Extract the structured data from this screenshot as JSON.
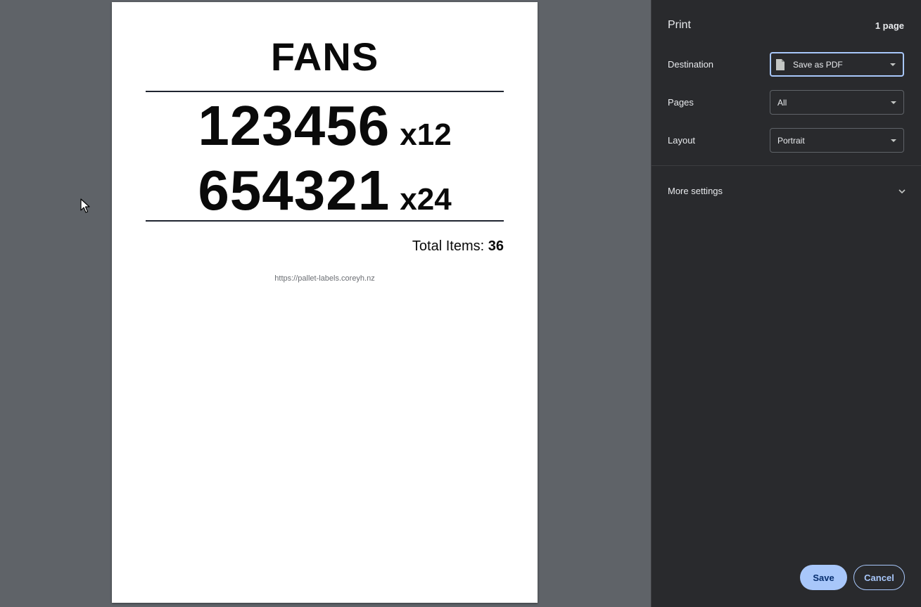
{
  "preview": {
    "document": {
      "title": "FANS",
      "items": [
        {
          "code": "123456",
          "qty": "x12"
        },
        {
          "code": "654321",
          "qty": "x24"
        }
      ],
      "total_label": "Total Items:",
      "total_value": "36",
      "footer_url": "https://pallet-labels.coreyh.nz"
    }
  },
  "sidebar": {
    "title": "Print",
    "page_count": "1 page",
    "destination": {
      "label": "Destination",
      "value": "Save as PDF",
      "icon": "file-icon"
    },
    "pages": {
      "label": "Pages",
      "value": "All"
    },
    "layout": {
      "label": "Layout",
      "value": "Portrait"
    },
    "more_settings": {
      "label": "More settings",
      "icon": "chevron-down-icon"
    },
    "buttons": {
      "save": "Save",
      "cancel": "Cancel"
    }
  },
  "colors": {
    "preview_background": "#5f6368",
    "sidebar_background": "#292a2d",
    "accent": "#a8c7fa"
  }
}
